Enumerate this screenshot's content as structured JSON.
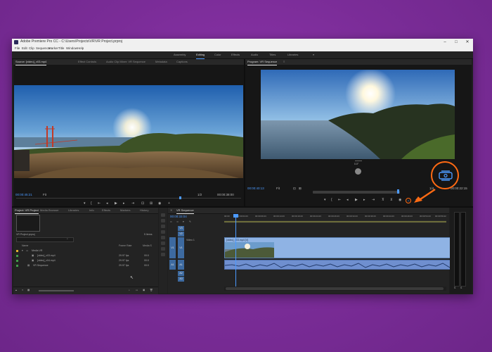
{
  "app": {
    "title": "Adobe Premiere Pro CC - C:\\Users\\Projects\\VR\\VR Project.prproj",
    "window_controls": [
      "–",
      "□",
      "✕"
    ]
  },
  "menu": [
    "File",
    "Edit",
    "Clip",
    "Sequence",
    "Marker",
    "Title",
    "Window",
    "Help"
  ],
  "workspaces": {
    "items": [
      "Assembly",
      "Editing",
      "Color",
      "Effects",
      "Audio",
      "Titles",
      "Libraries"
    ],
    "active_index": 1
  },
  "source_monitor": {
    "tabs": [
      "Source: [video]_v03.mp4",
      "Effect Controls",
      "Audio Clip Mixer: VR Sequence",
      "Metadata",
      "Captions"
    ],
    "active_tab": 0,
    "timecode_in": "00:00:45:21",
    "fit": "Fit",
    "fraction": "1/2",
    "timecode_out": "00:00:38:00"
  },
  "program_monitor": {
    "tabs": [
      "Program: VR Sequence"
    ],
    "timecode_in": "00:00:40:13",
    "fit": "Fit",
    "fraction": "1/4",
    "timecode_out": "00:00:22:15",
    "vr_button_label": "Toggle VR Video Display",
    "vr_readout": "0.0°",
    "highlight_color": "#ff6a13"
  },
  "project_panel": {
    "tabs": [
      "Project: VR Project",
      "Media Browser",
      "Libraries",
      "Info",
      "Effects",
      "Markers",
      "History"
    ],
    "active_tab": 0,
    "project_file": "VR Project.prproj",
    "item_count": "5 Items",
    "columns": [
      "Name",
      "Frame Rate",
      "Media S"
    ],
    "bins": [
      {
        "name": "Media VR",
        "color": "#e0b030"
      }
    ],
    "items": [
      {
        "name": "[video]_v03.mp4",
        "frame_rate": "29.97 fps",
        "media": "00:0",
        "color": "#3f9d4a"
      },
      {
        "name": "[video]_v04.mp4",
        "frame_rate": "29.97 fps",
        "media": "00:0",
        "color": "#3f9d4a"
      },
      {
        "name": "VR Sequence",
        "frame_rate": "29.97 fps",
        "media": "00:0",
        "color": "#3f9d4a"
      }
    ]
  },
  "timeline": {
    "tab": "VR Sequence",
    "timecode": "00:00:33:04",
    "ruler": [
      "00:00",
      "00:00:04:23",
      "00:00:09:23",
      "00:00:14:23",
      "00:00:19:23",
      "00:00:24:23",
      "00:00:29:23",
      "00:00:34:23",
      "00:00:39:23",
      "00:00:44:23",
      "00:00:49:23",
      "00:00:54:23",
      "00:00:59:22"
    ],
    "video_tracks": [
      "V3",
      "V2",
      "V1"
    ],
    "audio_tracks": [
      "A1",
      "A2",
      "A3"
    ],
    "clip_name": "[video]_v03.mp4 [V]",
    "track_label": "Video 1"
  }
}
